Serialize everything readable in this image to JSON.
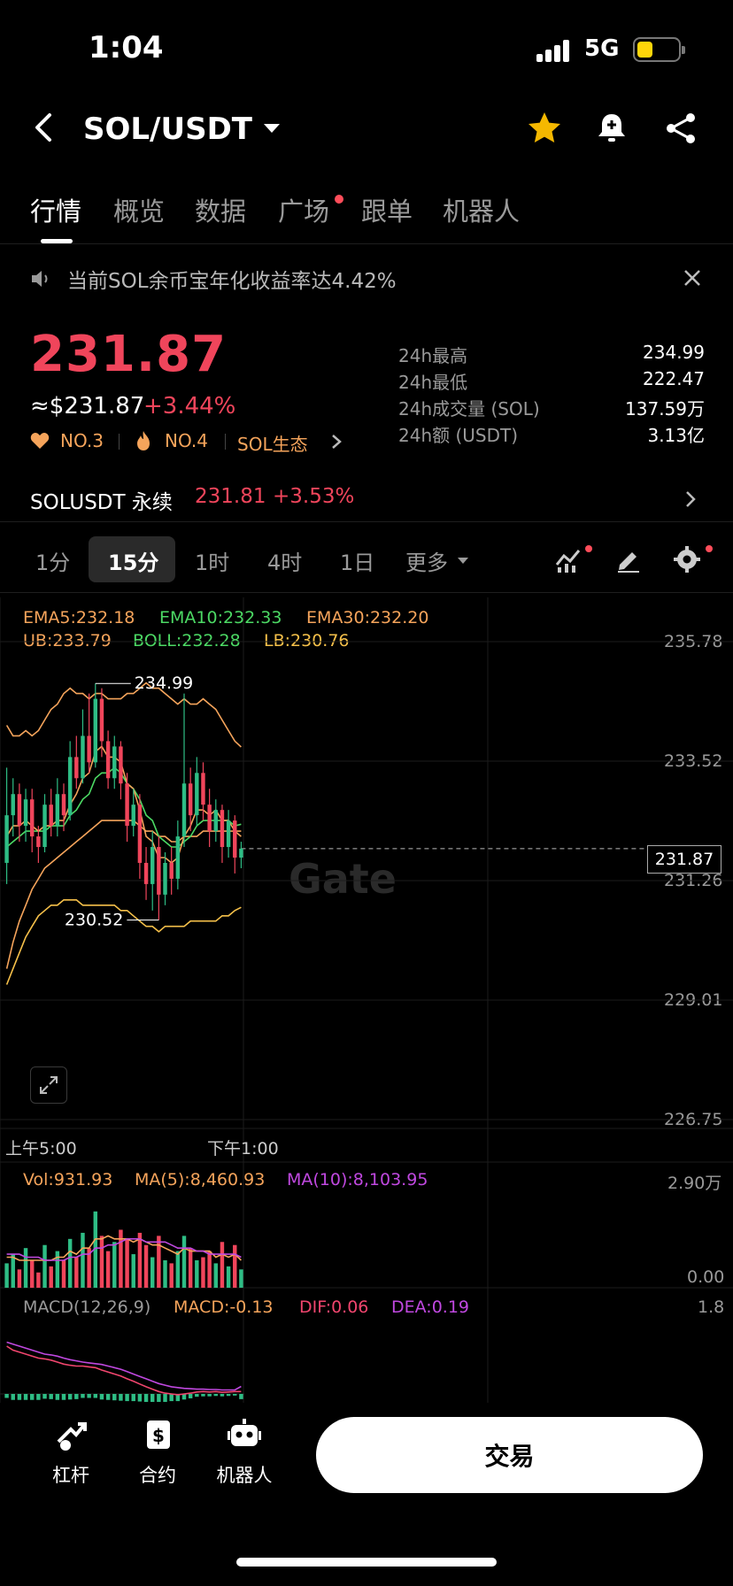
{
  "status_bar": {
    "time": "1:04",
    "network": "5G",
    "battery_percent": 30
  },
  "header": {
    "pair": "SOL/USDT",
    "icons": [
      "back-icon",
      "star-icon",
      "bell-plus-icon",
      "share-icon"
    ],
    "favorite_color": "#f5b800"
  },
  "tabs": [
    {
      "label": "行情",
      "active": true
    },
    {
      "label": "概览"
    },
    {
      "label": "数据"
    },
    {
      "label": "广场",
      "badge_dot": true
    },
    {
      "label": "跟单"
    },
    {
      "label": "机器人"
    }
  ],
  "notice": {
    "text": "当前SOL余币宝年化收益率达4.42%",
    "icon": "speaker-icon"
  },
  "price": {
    "last": "231.87",
    "usd": "≈$231.87",
    "change": "+3.44%",
    "ranks": [
      {
        "label": "NO.3",
        "icon": "heart-icon"
      },
      {
        "label": "NO.4",
        "icon": "fire-icon"
      },
      {
        "label": "SOL生态",
        "icon": "chevron-right-icon"
      }
    ],
    "up_color": "#f0455b",
    "rank_color": "#f5a45b"
  },
  "stats": [
    {
      "label": "24h最高",
      "value": "234.99"
    },
    {
      "label": "24h最低",
      "value": "222.47"
    },
    {
      "label": "24h成交量 (SOL)",
      "value": "137.59万"
    },
    {
      "label": "24h额 (USDT)",
      "value": "3.13亿"
    }
  ],
  "perpetual": {
    "name": "SOLUSDT 永续",
    "price": "231.81",
    "change": "+3.53%"
  },
  "intervals": {
    "items": [
      "1分",
      "15分",
      "1时",
      "4时",
      "1日",
      "更多"
    ],
    "active": "15分"
  },
  "main_indicators": {
    "ema5": "EMA5:232.18",
    "ema10": "EMA10:232.33",
    "ema30": "EMA30:232.20",
    "ub": "UB:233.79",
    "boll": "BOLL:232.28",
    "lb": "LB:230.76"
  },
  "price_axis": [
    "235.78",
    "233.52",
    "231.26",
    "229.01",
    "226.75"
  ],
  "current_price_tag": "231.87",
  "annotations": {
    "high": "234.99",
    "low": "230.52"
  },
  "time_axis": [
    "上午5:00",
    "下午1:00"
  ],
  "watermark": "Gate",
  "volume": {
    "vol": "Vol:931.93",
    "ma5": "MA(5):8,460.93",
    "ma10": "MA(10):8,103.95",
    "axis_top": "2.90万",
    "axis_bottom": "0.00"
  },
  "macd": {
    "label": "MACD(12,26,9)",
    "macd": "MACD:-0.13",
    "dif": "DIF:0.06",
    "dea": "DEA:0.19",
    "axis_top": "1.8"
  },
  "chart_data": {
    "type": "candlestick",
    "interval": "15分",
    "ylim": [
      226.75,
      235.78
    ],
    "y_ticks": [
      235.78,
      233.52,
      231.26,
      229.01,
      226.75
    ],
    "x_ticks": [
      "上午5:00",
      "下午1:00"
    ],
    "last_price": 231.87,
    "high": 234.99,
    "low": 230.52,
    "candles": [
      [
        231.6,
        232.5,
        233.4,
        231.2
      ],
      [
        232.5,
        232.9,
        233.2,
        232.1
      ],
      [
        232.9,
        232.3,
        233.1,
        232.0
      ],
      [
        232.3,
        232.8,
        233.0,
        232.0
      ],
      [
        232.8,
        232.1,
        233.0,
        231.8
      ],
      [
        232.1,
        231.9,
        232.3,
        231.6
      ],
      [
        231.9,
        232.7,
        232.9,
        231.8
      ],
      [
        232.7,
        232.3,
        233.0,
        232.1
      ],
      [
        232.3,
        232.9,
        233.2,
        232.1
      ],
      [
        232.9,
        232.5,
        233.1,
        232.2
      ],
      [
        232.5,
        233.6,
        233.9,
        232.4
      ],
      [
        233.6,
        233.2,
        234.0,
        233.0
      ],
      [
        233.2,
        234.0,
        234.5,
        233.1
      ],
      [
        234.0,
        233.5,
        234.8,
        233.3
      ],
      [
        233.5,
        234.7,
        234.99,
        233.4
      ],
      [
        234.7,
        233.9,
        234.9,
        233.6
      ],
      [
        233.9,
        233.2,
        234.1,
        233.0
      ],
      [
        233.2,
        233.8,
        234.0,
        233.0
      ],
      [
        233.8,
        233.1,
        233.9,
        232.8
      ],
      [
        233.1,
        232.3,
        233.3,
        232.0
      ],
      [
        232.3,
        232.7,
        233.0,
        232.1
      ],
      [
        232.7,
        231.6,
        232.9,
        231.3
      ],
      [
        231.6,
        231.2,
        231.9,
        230.9
      ],
      [
        231.2,
        231.9,
        232.2,
        230.7
      ],
      [
        231.9,
        231.0,
        232.1,
        230.52
      ],
      [
        231.0,
        231.6,
        231.8,
        230.8
      ],
      [
        231.6,
        231.3,
        231.9,
        231.0
      ],
      [
        231.3,
        232.1,
        232.4,
        231.1
      ],
      [
        232.1,
        233.1,
        234.8,
        231.9
      ],
      [
        233.1,
        232.5,
        233.4,
        232.2
      ],
      [
        232.5,
        233.3,
        233.6,
        232.3
      ],
      [
        233.3,
        232.7,
        233.5,
        232.4
      ],
      [
        232.7,
        232.2,
        233.0,
        231.9
      ],
      [
        232.2,
        232.6,
        232.8,
        232.0
      ],
      [
        232.6,
        231.9,
        232.7,
        231.6
      ],
      [
        231.9,
        232.4,
        232.6,
        231.7
      ],
      [
        232.4,
        231.7,
        232.5,
        231.4
      ],
      [
        231.7,
        231.87,
        232.0,
        231.5
      ]
    ],
    "ema5": [
      232.1,
      232.3,
      232.3,
      232.4,
      232.3,
      232.2,
      232.3,
      232.3,
      232.4,
      232.4,
      232.7,
      232.9,
      233.2,
      233.3,
      233.7,
      233.8,
      233.6,
      233.6,
      233.5,
      233.1,
      233.0,
      232.6,
      232.1,
      232.0,
      231.7,
      231.7,
      231.6,
      231.7,
      232.1,
      232.3,
      232.6,
      232.6,
      232.5,
      232.6,
      232.4,
      232.4,
      232.2,
      232.1
    ],
    "ema10": [
      231.9,
      232.0,
      232.1,
      232.2,
      232.2,
      232.2,
      232.2,
      232.3,
      232.3,
      232.3,
      232.5,
      232.6,
      232.8,
      232.9,
      233.2,
      233.3,
      233.3,
      233.4,
      233.3,
      233.1,
      233.0,
      232.8,
      232.5,
      232.4,
      232.1,
      232.0,
      231.9,
      231.9,
      232.0,
      232.1,
      232.3,
      232.4,
      232.4,
      232.4,
      232.4,
      232.4,
      232.3,
      232.33
    ],
    "ema30": [
      229.6,
      230.1,
      230.5,
      230.8,
      231.1,
      231.3,
      231.5,
      231.6,
      231.7,
      231.8,
      231.9,
      232.0,
      232.1,
      232.2,
      232.3,
      232.4,
      232.4,
      232.4,
      232.4,
      232.4,
      232.4,
      232.3,
      232.2,
      232.2,
      232.1,
      232.1,
      232.0,
      232.0,
      232.1,
      232.1,
      232.1,
      232.2,
      232.2,
      232.2,
      232.2,
      232.2,
      232.2,
      232.2
    ],
    "boll_ub": [
      234.2,
      234.0,
      234.0,
      234.1,
      234.0,
      234.1,
      234.3,
      234.5,
      234.6,
      234.8,
      234.9,
      234.8,
      234.8,
      234.7,
      234.8,
      234.8,
      234.7,
      234.7,
      234.7,
      234.8,
      234.8,
      234.9,
      235.0,
      234.9,
      234.9,
      234.8,
      234.7,
      234.6,
      234.7,
      234.6,
      234.6,
      234.7,
      234.6,
      234.5,
      234.3,
      234.1,
      233.9,
      233.79
    ],
    "boll_lb": [
      229.3,
      229.6,
      229.9,
      230.2,
      230.4,
      230.6,
      230.7,
      230.8,
      230.8,
      230.9,
      230.9,
      230.9,
      230.8,
      230.8,
      230.8,
      230.8,
      230.8,
      230.8,
      230.7,
      230.7,
      230.6,
      230.5,
      230.4,
      230.4,
      230.3,
      230.4,
      230.4,
      230.4,
      230.4,
      230.5,
      230.5,
      230.5,
      230.5,
      230.5,
      230.6,
      230.6,
      230.7,
      230.76
    ],
    "volume": [
      0.8,
      1.1,
      0.6,
      1.3,
      0.9,
      0.5,
      1.4,
      0.7,
      1.2,
      0.9,
      1.6,
      1.0,
      1.8,
      1.3,
      2.5,
      1.7,
      1.2,
      1.5,
      1.9,
      1.6,
      1.1,
      1.8,
      1.4,
      1.0,
      1.7,
      0.9,
      0.8,
      1.2,
      1.7,
      1.3,
      0.9,
      1.0,
      1.2,
      0.8,
      1.5,
      0.7,
      1.4,
      0.6
    ],
    "volume_ma5": [
      1.0,
      1.0,
      0.9,
      0.9,
      0.9,
      0.9,
      0.9,
      0.9,
      1.0,
      1.0,
      1.2,
      1.1,
      1.3,
      1.3,
      1.6,
      1.6,
      1.7,
      1.6,
      1.6,
      1.6,
      1.5,
      1.6,
      1.5,
      1.4,
      1.4,
      1.3,
      1.2,
      1.1,
      1.3,
      1.2,
      1.2,
      1.2,
      1.2,
      1.0,
      1.1,
      1.0,
      1.1,
      0.9
    ],
    "volume_ma10": [
      1.1,
      1.1,
      1.1,
      1.0,
      1.0,
      1.0,
      0.9,
      0.9,
      0.9,
      0.9,
      1.0,
      1.0,
      1.1,
      1.1,
      1.3,
      1.3,
      1.4,
      1.4,
      1.5,
      1.6,
      1.6,
      1.6,
      1.5,
      1.5,
      1.5,
      1.5,
      1.4,
      1.3,
      1.3,
      1.3,
      1.2,
      1.2,
      1.1,
      1.1,
      1.1,
      1.1,
      1.1,
      1.0
    ],
    "macd_dif": [
      1.2,
      1.1,
      1.05,
      1.0,
      0.95,
      0.9,
      0.88,
      0.85,
      0.8,
      0.75,
      0.72,
      0.7,
      0.7,
      0.68,
      0.66,
      0.6,
      0.55,
      0.5,
      0.45,
      0.38,
      0.32,
      0.25,
      0.18,
      0.12,
      0.06,
      0.02,
      0.0,
      -0.02,
      0.0,
      0.02,
      0.05,
      0.06,
      0.05,
      0.06,
      0.04,
      0.05,
      0.06,
      0.06
    ],
    "macd_dea": [
      1.3,
      1.25,
      1.2,
      1.15,
      1.1,
      1.05,
      1.0,
      0.98,
      0.95,
      0.9,
      0.86,
      0.83,
      0.8,
      0.78,
      0.76,
      0.74,
      0.7,
      0.66,
      0.62,
      0.56,
      0.5,
      0.44,
      0.38,
      0.32,
      0.26,
      0.22,
      0.18,
      0.16,
      0.14,
      0.13,
      0.12,
      0.12,
      0.11,
      0.11,
      0.1,
      0.1,
      0.1,
      0.19
    ],
    "macd_hist": [
      -0.1,
      -0.15,
      -0.15,
      -0.15,
      -0.15,
      -0.15,
      -0.12,
      -0.13,
      -0.15,
      -0.15,
      -0.14,
      -0.13,
      -0.1,
      -0.1,
      -0.1,
      -0.14,
      -0.15,
      -0.16,
      -0.17,
      -0.18,
      -0.18,
      -0.19,
      -0.2,
      -0.2,
      -0.2,
      -0.2,
      -0.18,
      -0.18,
      -0.14,
      -0.11,
      -0.07,
      -0.06,
      -0.06,
      -0.05,
      -0.06,
      -0.05,
      -0.04,
      -0.13
    ]
  },
  "bottom_nav": [
    {
      "label": "杠杆",
      "icon": "leverage-icon"
    },
    {
      "label": "合约",
      "icon": "contract-icon"
    },
    {
      "label": "机器人",
      "icon": "robot-icon"
    }
  ],
  "trade_button": "交易"
}
